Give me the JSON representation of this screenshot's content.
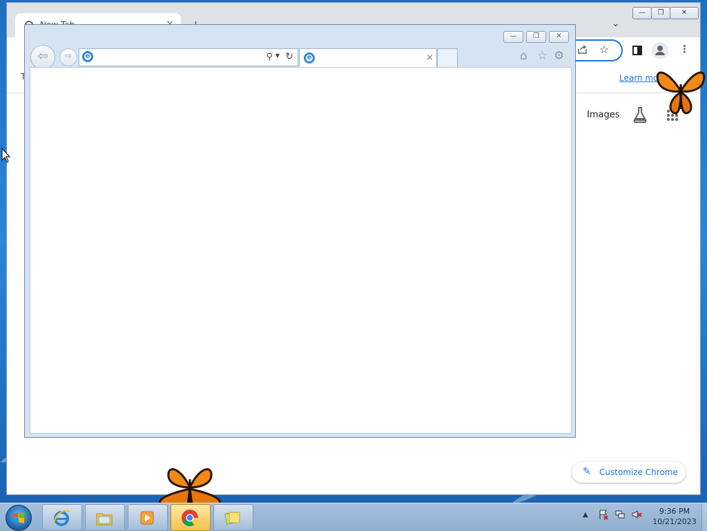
{
  "chrome": {
    "tab_title": "New Tab",
    "tab_close": "×",
    "new_tab": "+",
    "tab_search": "⌄",
    "win_minimize": "—",
    "win_restore": "❐",
    "win_close": "✕",
    "bookmarks_left": "T",
    "learn_more": "Learn more",
    "images_link": "Images",
    "customize_label": "Customize Chrome",
    "accent_color": "#1a73e8"
  },
  "ie": {
    "address_value": "",
    "tab_title": "",
    "tab_close": "×",
    "controls": {
      "minimize": "—",
      "restore": "❐",
      "close": "✕"
    }
  },
  "taskbar": {
    "clock_time": "9:36 PM",
    "clock_date": "10/21/2023",
    "pinned": [
      {
        "name": "Internet Explorer",
        "icon": "ie-icon"
      },
      {
        "name": "Windows Explorer",
        "icon": "folder-icon"
      },
      {
        "name": "Windows Media Player",
        "icon": "media-player-icon"
      },
      {
        "name": "Google Chrome",
        "icon": "chrome-icon",
        "active": true
      },
      {
        "name": "Sticky Notes",
        "icon": "sticky-notes-icon"
      }
    ],
    "tray_icons": [
      "show-hidden-icons-arrow",
      "action-center-flag-icon",
      "network-icon",
      "volume-muted-icon"
    ]
  }
}
